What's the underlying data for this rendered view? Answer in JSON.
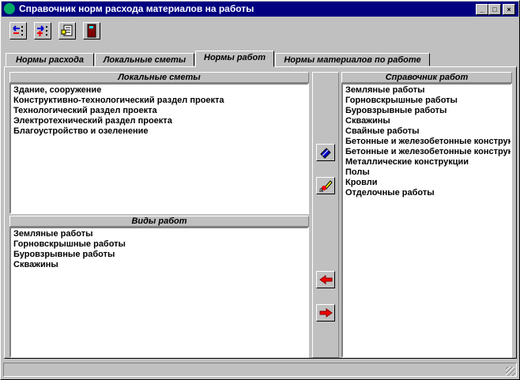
{
  "window": {
    "title": "Справочник норм расхода материалов на работы",
    "minimize": "_",
    "maximize": "□",
    "close": "×"
  },
  "toolbar": [
    {
      "icon": "remove-icon"
    },
    {
      "icon": "add-icon"
    },
    {
      "icon": "report-icon"
    },
    {
      "icon": "exit-door-icon"
    }
  ],
  "tabs": [
    {
      "label": "Нормы расхода"
    },
    {
      "label": "Локальные сметы"
    },
    {
      "label": "Нормы работ",
      "selected": true
    },
    {
      "label": "Нормы материалов по работе"
    }
  ],
  "local_estimates": {
    "header": "Локальные сметы",
    "items": [
      "Здание, сооружение",
      "Конструктивно-технологический раздел проекта",
      "Технологический раздел проекта",
      "Электротехнический раздел проекта",
      "Благоустройство и озеленение"
    ]
  },
  "work_types": {
    "header": "Виды работ",
    "items": [
      "Земляные работы",
      "Горновскрышные работы",
      "Буровзрывные работы",
      "Скважины"
    ]
  },
  "works_catalog": {
    "header": "Справочник работ",
    "items": [
      "Земляные работы",
      "Горновскрышные работы",
      "Буровзрывные работы",
      "Скважины",
      "Свайные работы",
      "Бетонные и железобетонные конструкции",
      "Бетонные и железобетонные конструкции",
      "Металлические конструкции",
      "Полы",
      "Кровли",
      "Отделочные работы"
    ]
  },
  "middle_buttons": [
    {
      "icon": "book-icon"
    },
    {
      "icon": "eraser-icon"
    },
    {
      "icon": "arrow-left-icon"
    },
    {
      "icon": "arrow-right-icon"
    }
  ]
}
